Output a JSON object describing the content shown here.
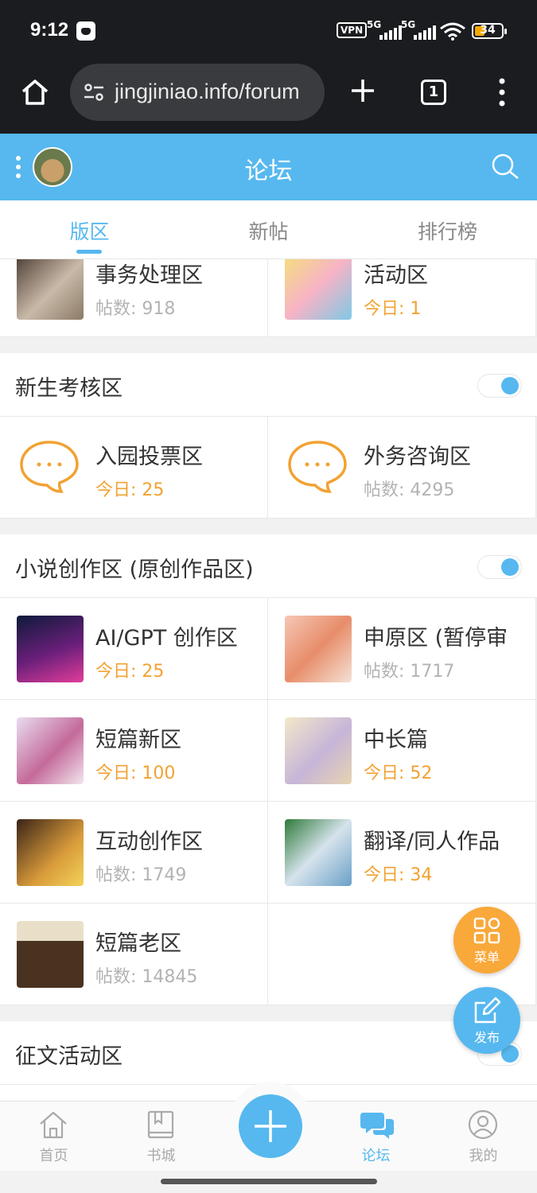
{
  "status_bar": {
    "time": "9:12",
    "vpn": "VPN",
    "net1": "5G",
    "net2": "5G",
    "battery": "34"
  },
  "browser": {
    "url": "jingjiniao.info/forum",
    "tab_count": "1"
  },
  "header": {
    "title": "论坛"
  },
  "tabs": [
    {
      "label": "版区",
      "active": true
    },
    {
      "label": "新帖",
      "active": false
    },
    {
      "label": "排行榜",
      "active": false
    }
  ],
  "top_forums": [
    {
      "name": "事务处理区",
      "stat": "帖数: 918"
    },
    {
      "name": "活动区",
      "stat": "今日: 1"
    }
  ],
  "sections": [
    {
      "title": "新生考核区",
      "forums": [
        {
          "name": "入园投票区",
          "stat": "今日: 25"
        },
        {
          "name": "外务咨询区",
          "stat": "帖数: 4295"
        }
      ]
    },
    {
      "title": "小说创作区 (原创作品区)",
      "forums": [
        {
          "name": "AI/GPT 创作区",
          "stat": "今日: 25"
        },
        {
          "name": "申原区 (暂停审",
          "stat": "帖数: 1717"
        },
        {
          "name": "短篇新区",
          "stat": "今日: 100"
        },
        {
          "name": "中长篇",
          "stat": "今日: 52"
        },
        {
          "name": "互动创作区",
          "stat": "帖数: 1749"
        },
        {
          "name": "翻译/同人作品",
          "stat": "今日: 34"
        },
        {
          "name": "短篇老区",
          "stat": "帖数: 14845"
        }
      ]
    },
    {
      "title": "征文活动区"
    }
  ],
  "fab": {
    "menu": "菜单",
    "post": "发布"
  },
  "bottom_nav": [
    {
      "label": "首页",
      "icon": "home-icon"
    },
    {
      "label": "书城",
      "icon": "book-icon"
    },
    {
      "label": "论坛",
      "icon": "chat-bubbles-icon",
      "active": true
    },
    {
      "label": "我的",
      "icon": "user-icon"
    }
  ],
  "colors": {
    "accent": "#56b8ef",
    "orange": "#f2a232",
    "fab_menu": "#f9a83a"
  }
}
